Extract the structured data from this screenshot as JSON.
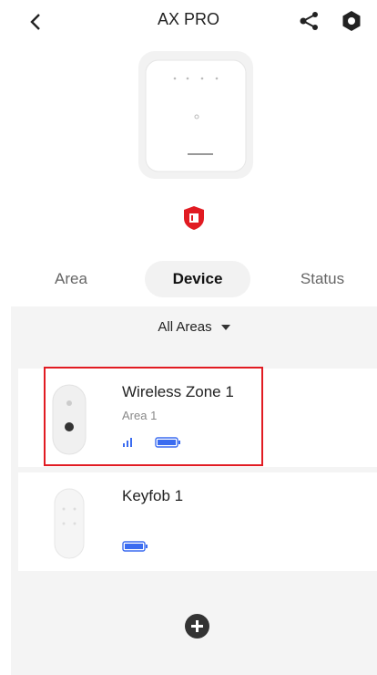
{
  "header": {
    "title": "AX PRO"
  },
  "tabs": [
    {
      "label": "Area"
    },
    {
      "label": "Device"
    },
    {
      "label": "Status"
    }
  ],
  "filter": {
    "label": "All Areas"
  },
  "devices": [
    {
      "name": "Wireless Zone 1",
      "area": "Area 1",
      "signal": "signal-icon",
      "battery": "battery-icon"
    },
    {
      "name": "Keyfob 1",
      "area": "",
      "battery": "battery-icon"
    }
  ],
  "colors": {
    "accent": "#e11b22",
    "battery": "#3b6cf0"
  }
}
